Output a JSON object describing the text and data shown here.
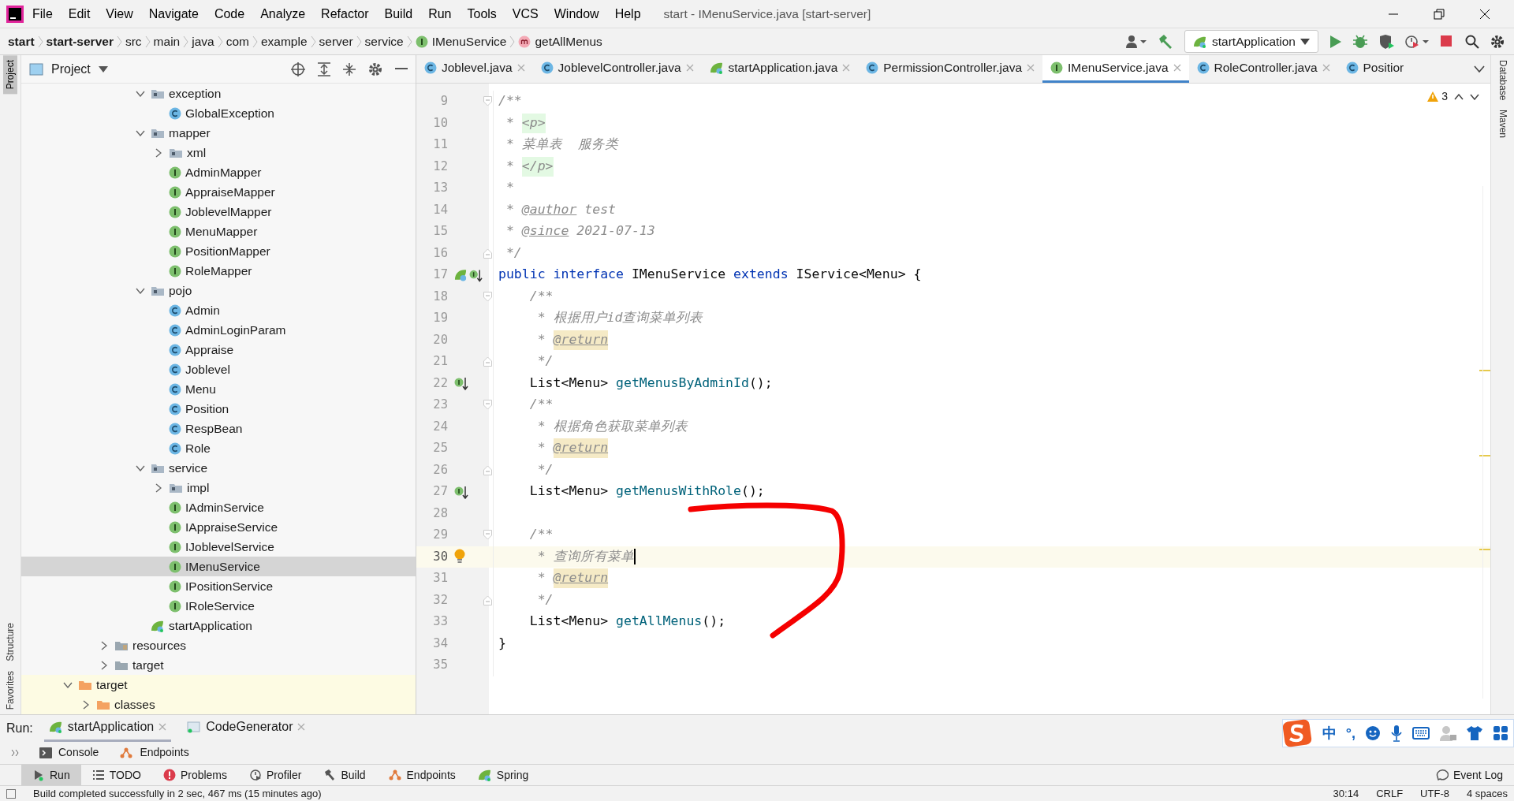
{
  "window": {
    "title": "start - IMenuService.java [start-server]"
  },
  "menu": [
    "File",
    "Edit",
    "View",
    "Navigate",
    "Code",
    "Analyze",
    "Refactor",
    "Build",
    "Run",
    "Tools",
    "VCS",
    "Window",
    "Help"
  ],
  "breadcrumbs": [
    {
      "label": "start",
      "bold": true,
      "kind": "plain"
    },
    {
      "label": "start-server",
      "bold": true,
      "kind": "plain"
    },
    {
      "label": "src",
      "bold": false,
      "kind": "plain"
    },
    {
      "label": "main",
      "bold": false,
      "kind": "plain"
    },
    {
      "label": "java",
      "bold": false,
      "kind": "plain"
    },
    {
      "label": "com",
      "bold": false,
      "kind": "plain"
    },
    {
      "label": "example",
      "bold": false,
      "kind": "plain"
    },
    {
      "label": "server",
      "bold": false,
      "kind": "plain"
    },
    {
      "label": "service",
      "bold": false,
      "kind": "plain"
    },
    {
      "label": "IMenuService",
      "bold": false,
      "kind": "interface"
    },
    {
      "label": "getAllMenus",
      "bold": false,
      "kind": "method"
    }
  ],
  "run_config": {
    "label": "startApplication"
  },
  "side_stripes": {
    "left": [
      {
        "label": "Project",
        "selected": true
      },
      {
        "label": "Structure",
        "selected": false
      },
      {
        "label": "Favorites",
        "selected": false
      }
    ],
    "right": [
      "Database",
      "Maven"
    ]
  },
  "project_panel": {
    "title": "Project",
    "tree": [
      {
        "children": [
          {
            "children": [
              {
                "children": [
                  {
                    "children": [
                      {
                        "label": "exception",
                        "kind": "package",
                        "expanded": true,
                        "selected": false,
                        "children": [
                          {
                            "label": "GlobalException",
                            "kind": "class",
                            "selected": false
                          }
                        ]
                      },
                      {
                        "label": "mapper",
                        "kind": "package",
                        "expanded": true,
                        "selected": false,
                        "children": [
                          {
                            "label": "xml",
                            "kind": "package",
                            "expanded": false,
                            "selected": false
                          },
                          {
                            "label": "AdminMapper",
                            "kind": "interface",
                            "selected": false
                          },
                          {
                            "label": "AppraiseMapper",
                            "kind": "interface",
                            "selected": false
                          },
                          {
                            "label": "JoblevelMapper",
                            "kind": "interface",
                            "selected": false
                          },
                          {
                            "label": "MenuMapper",
                            "kind": "interface",
                            "selected": false
                          },
                          {
                            "label": "PositionMapper",
                            "kind": "interface",
                            "selected": false
                          },
                          {
                            "label": "RoleMapper",
                            "kind": "interface",
                            "selected": false
                          }
                        ]
                      },
                      {
                        "label": "pojo",
                        "kind": "package",
                        "expanded": true,
                        "selected": false,
                        "children": [
                          {
                            "label": "Admin",
                            "kind": "class",
                            "selected": false
                          },
                          {
                            "label": "AdminLoginParam",
                            "kind": "class",
                            "selected": false
                          },
                          {
                            "label": "Appraise",
                            "kind": "class",
                            "selected": false
                          },
                          {
                            "label": "Joblevel",
                            "kind": "class",
                            "selected": false
                          },
                          {
                            "label": "Menu",
                            "kind": "class",
                            "selected": false
                          },
                          {
                            "label": "Position",
                            "kind": "class",
                            "selected": false
                          },
                          {
                            "label": "RespBean",
                            "kind": "class",
                            "selected": false
                          },
                          {
                            "label": "Role",
                            "kind": "class",
                            "selected": false
                          }
                        ]
                      },
                      {
                        "label": "service",
                        "kind": "package",
                        "expanded": true,
                        "selected": false,
                        "children": [
                          {
                            "label": "impl",
                            "kind": "package",
                            "expanded": false,
                            "selected": false
                          },
                          {
                            "label": "IAdminService",
                            "kind": "interface",
                            "selected": false
                          },
                          {
                            "label": "IAppraiseService",
                            "kind": "interface",
                            "selected": false
                          },
                          {
                            "label": "IJoblevelService",
                            "kind": "interface",
                            "selected": false
                          },
                          {
                            "label": "IMenuService",
                            "kind": "interface",
                            "selected": true
                          },
                          {
                            "label": "IPositionService",
                            "kind": "interface",
                            "selected": false
                          },
                          {
                            "label": "IRoleService",
                            "kind": "interface",
                            "selected": false
                          }
                        ]
                      },
                      {
                        "label": "startApplication",
                        "kind": "spring-class",
                        "selected": false
                      }
                    ]
                  }
                ]
              },
              {
                "label": "resources",
                "kind": "resources",
                "expanded": false,
                "selected": false
              },
              {
                "label": "target",
                "kind": "folder",
                "expanded": false,
                "selected": false
              }
            ]
          }
        ]
      },
      {
        "label": "target",
        "kind": "excluded-folder",
        "expanded": true,
        "selected": false,
        "children": [
          {
            "label": "classes",
            "kind": "excluded-folder",
            "expanded": false,
            "selected": false
          }
        ]
      }
    ]
  },
  "editor_tabs": [
    {
      "label": "Joblevel.java",
      "kind": "class",
      "selected": false,
      "closable": true
    },
    {
      "label": "JoblevelController.java",
      "kind": "class",
      "selected": false,
      "closable": true
    },
    {
      "label": "startApplication.java",
      "kind": "spring-class",
      "selected": false,
      "closable": true
    },
    {
      "label": "PermissionController.java",
      "kind": "class",
      "selected": false,
      "closable": true
    },
    {
      "label": "IMenuService.java",
      "kind": "interface",
      "selected": true,
      "closable": true
    },
    {
      "label": "RoleController.java",
      "kind": "class",
      "selected": false,
      "closable": true
    },
    {
      "label": "Positior",
      "kind": "class",
      "selected": false,
      "closable": false
    }
  ],
  "editor": {
    "warnings": "3",
    "lines": [
      {
        "number": "9",
        "fold": {
          "kind": "start"
        },
        "current": false,
        "tokens": [
          {
            "text": "/**",
            "kind": "comment"
          }
        ]
      },
      {
        "number": "10",
        "current": false,
        "tokens": [
          {
            "text": " * ",
            "kind": "comment"
          },
          {
            "text": "<p>",
            "kind": "html"
          }
        ]
      },
      {
        "number": "11",
        "current": false,
        "tokens": [
          {
            "text": " * 菜单表  服务类",
            "kind": "comment"
          }
        ]
      },
      {
        "number": "12",
        "current": false,
        "tokens": [
          {
            "text": " * ",
            "kind": "comment"
          },
          {
            "text": "</p>",
            "kind": "html"
          }
        ]
      },
      {
        "number": "13",
        "current": false,
        "tokens": [
          {
            "text": " *",
            "kind": "comment"
          }
        ]
      },
      {
        "number": "14",
        "current": false,
        "tokens": [
          {
            "text": " * ",
            "kind": "comment"
          },
          {
            "text": "@author",
            "kind": "doctag"
          },
          {
            "text": " test",
            "kind": "comment"
          }
        ]
      },
      {
        "number": "15",
        "current": false,
        "tokens": [
          {
            "text": " * ",
            "kind": "comment"
          },
          {
            "text": "@since",
            "kind": "doctag"
          },
          {
            "text": " 2021-07-13",
            "kind": "comment"
          }
        ]
      },
      {
        "number": "16",
        "fold": {
          "kind": "end"
        },
        "current": false,
        "tokens": [
          {
            "text": " */",
            "kind": "comment"
          }
        ]
      },
      {
        "number": "17",
        "current": false,
        "gutter": [
          {
            "kind": "bean"
          },
          {
            "kind": "implemented"
          }
        ],
        "tokens": [
          {
            "text": "public interface",
            "kind": "keyword"
          },
          {
            "text": " IMenuService ",
            "kind": "plain"
          },
          {
            "text": "extends",
            "kind": "keyword"
          },
          {
            "text": " IService<Menu> {",
            "kind": "plain"
          }
        ]
      },
      {
        "number": "18",
        "fold": {
          "kind": "start"
        },
        "current": false,
        "tokens": [
          {
            "text": "    /**",
            "kind": "comment"
          }
        ]
      },
      {
        "number": "19",
        "current": false,
        "tokens": [
          {
            "text": "     * 根据用户id查询菜单列表",
            "kind": "comment"
          }
        ]
      },
      {
        "number": "20",
        "current": false,
        "tokens": [
          {
            "text": "     * ",
            "kind": "comment"
          },
          {
            "text": "@return",
            "kind": "doctag-hl"
          }
        ]
      },
      {
        "number": "21",
        "fold": {
          "kind": "end"
        },
        "current": false,
        "tokens": [
          {
            "text": "     */",
            "kind": "comment"
          }
        ]
      },
      {
        "number": "22",
        "current": false,
        "gutter": [
          {
            "kind": "implemented"
          }
        ],
        "tokens": [
          {
            "text": "    List<Menu> ",
            "kind": "plain"
          },
          {
            "text": "getMenusByAdminId",
            "kind": "method"
          },
          {
            "text": "();",
            "kind": "plain"
          }
        ]
      },
      {
        "number": "23",
        "fold": {
          "kind": "start"
        },
        "current": false,
        "tokens": [
          {
            "text": "    /**",
            "kind": "comment"
          }
        ]
      },
      {
        "number": "24",
        "current": false,
        "tokens": [
          {
            "text": "     * 根据角色获取菜单列表",
            "kind": "comment"
          }
        ]
      },
      {
        "number": "25",
        "current": false,
        "tokens": [
          {
            "text": "     * ",
            "kind": "comment"
          },
          {
            "text": "@return",
            "kind": "doctag-hl"
          }
        ]
      },
      {
        "number": "26",
        "fold": {
          "kind": "end"
        },
        "current": false,
        "tokens": [
          {
            "text": "     */",
            "kind": "comment"
          }
        ]
      },
      {
        "number": "27",
        "current": false,
        "gutter": [
          {
            "kind": "implemented"
          }
        ],
        "tokens": [
          {
            "text": "    List<Menu> ",
            "kind": "plain"
          },
          {
            "text": "getMenusWithRole",
            "kind": "method"
          },
          {
            "text": "();",
            "kind": "plain"
          }
        ]
      },
      {
        "number": "28",
        "current": false
      },
      {
        "number": "29",
        "fold": {
          "kind": "start"
        },
        "current": false,
        "tokens": [
          {
            "text": "    /**",
            "kind": "comment"
          }
        ]
      },
      {
        "number": "30",
        "current": true,
        "gutter": [
          {
            "kind": "intention"
          }
        ],
        "tokens": [
          {
            "text": "     * 查询所有菜单",
            "kind": "comment"
          }
        ]
      },
      {
        "number": "31",
        "current": false,
        "tokens": [
          {
            "text": "     * ",
            "kind": "comment"
          },
          {
            "text": "@return",
            "kind": "doctag-hl"
          }
        ]
      },
      {
        "number": "32",
        "fold": {
          "kind": "end"
        },
        "current": false,
        "tokens": [
          {
            "text": "     */",
            "kind": "comment"
          }
        ]
      },
      {
        "number": "33",
        "current": false,
        "tokens": [
          {
            "text": "    List<Menu> ",
            "kind": "plain"
          },
          {
            "text": "getAllMenus",
            "kind": "method"
          },
          {
            "text": "();",
            "kind": "plain"
          }
        ]
      },
      {
        "number": "34",
        "current": false,
        "tokens": [
          {
            "text": "}",
            "kind": "plain"
          }
        ]
      },
      {
        "number": "35",
        "current": false
      }
    ]
  },
  "run_panel": {
    "title": "Run:",
    "tabs": [
      {
        "label": "startApplication",
        "kind": "spring",
        "selected": true
      },
      {
        "label": "CodeGenerator",
        "kind": "app",
        "selected": false
      }
    ],
    "subtabs": [
      {
        "label": "Console",
        "kind": "console"
      },
      {
        "label": "Endpoints",
        "kind": "endpoints"
      }
    ]
  },
  "tool_strip": {
    "items": [
      {
        "label": "Run",
        "kind": "run",
        "selected": true
      },
      {
        "label": "TODO",
        "kind": "todo",
        "selected": false
      },
      {
        "label": "Problems",
        "kind": "problems",
        "selected": false
      },
      {
        "label": "Profiler",
        "kind": "profiler",
        "selected": false
      },
      {
        "label": "Build",
        "kind": "build",
        "selected": false
      },
      {
        "label": "Endpoints",
        "kind": "endpoints",
        "selected": false
      },
      {
        "label": "Spring",
        "kind": "spring",
        "selected": false
      }
    ],
    "right": "Event Log"
  },
  "status_bar": {
    "message": "Build completed successfully in 2 sec, 467 ms (15 minutes ago)",
    "position": "30:14",
    "line_separator": "CRLF",
    "encoding": "UTF-8",
    "indent": "4 spaces"
  },
  "ime_toolbar": {
    "mode": "中",
    "punctuation": "°,"
  }
}
